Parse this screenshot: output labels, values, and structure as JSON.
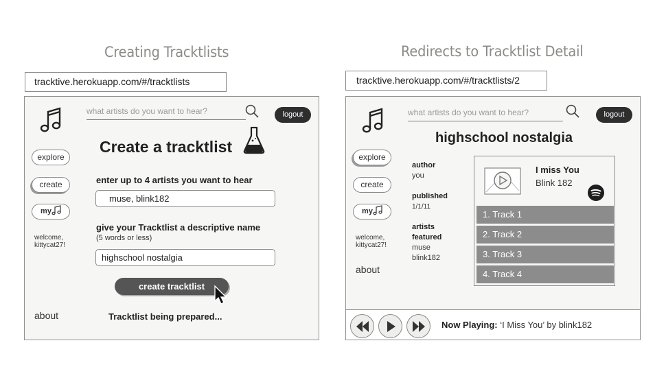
{
  "left": {
    "caption": "Creating Tracktlists",
    "url": "tracktive.herokuapp.com/#/tracktlists",
    "search_placeholder": "what artists do you want to hear?",
    "logout": "logout",
    "nav": {
      "explore": "explore",
      "create": "create",
      "my": "my"
    },
    "welcome_line1": "welcome,",
    "welcome_line2": "kittycat27!",
    "about": "about",
    "heading": "Create a tracktlist",
    "artists_label": "enter up to 4 artists you want to hear",
    "artists_value": "muse, blink182",
    "name_label": "give your Tracktlist a descriptive name",
    "name_hint": "(5 words or less)",
    "name_value": "highschool nostalgia",
    "create_button": "create tracktlist",
    "status": "Tracktlist being prepared..."
  },
  "right": {
    "caption": "Redirects to Tracktlist Detail",
    "url": "tracktive.herokuapp.com/#/tracktlists/2",
    "search_placeholder": "what artists do you want to hear?",
    "logout": "logout",
    "nav": {
      "explore": "explore",
      "create": "create",
      "my": "my"
    },
    "welcome_line1": "welcome,",
    "welcome_line2": "kittycat27!",
    "about": "about",
    "title": "highschool nostalgia",
    "author_label": "author",
    "author_value": "you",
    "published_label": "published",
    "published_value": "1/1/11",
    "artists_label_1": "artists",
    "artists_label_2": "featured",
    "artists": [
      "muse",
      "blink182"
    ],
    "song_title": "I miss You",
    "song_artist": "Blink 182",
    "tracks": [
      "1. Track 1",
      "2. Track 2",
      "3. Track 3",
      "4. Track 4"
    ],
    "now_playing_label": "Now Playing:",
    "now_playing_value": " ‘I Miss You’ by blink182"
  }
}
